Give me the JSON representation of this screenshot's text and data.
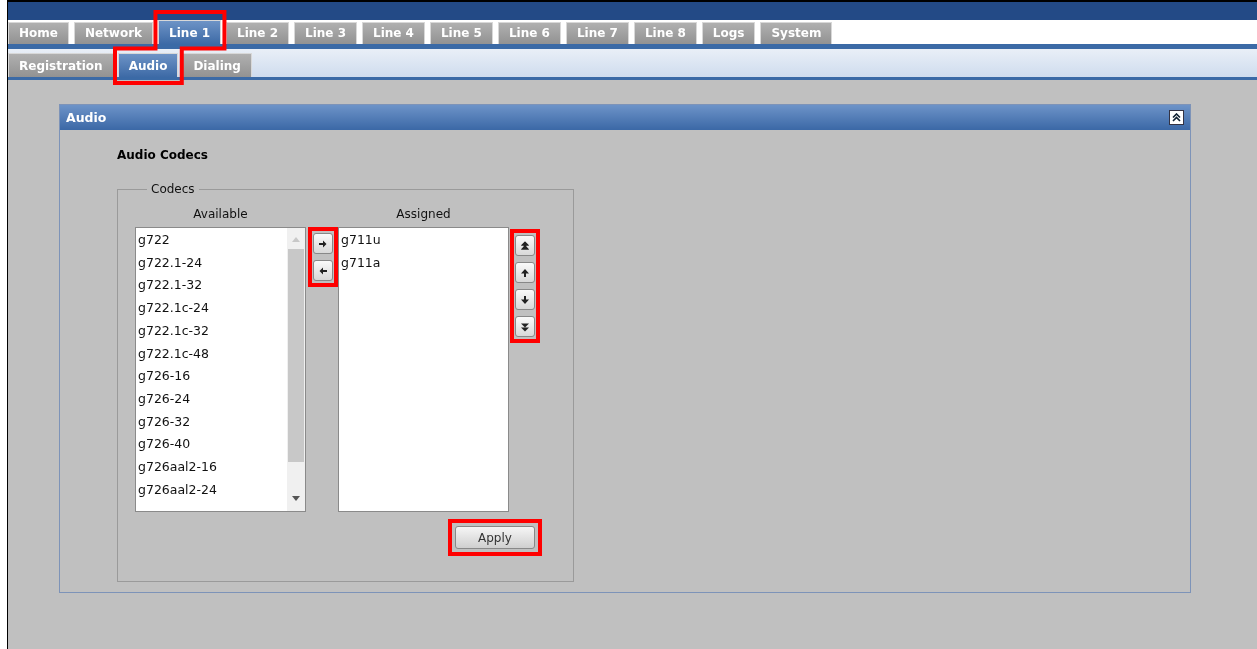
{
  "top_tabs": [
    {
      "label": "Home",
      "selected": false,
      "highlighted": false
    },
    {
      "label": "Network",
      "selected": false,
      "highlighted": false
    },
    {
      "label": "Line 1",
      "selected": true,
      "highlighted": true
    },
    {
      "label": "Line 2",
      "selected": false,
      "highlighted": false
    },
    {
      "label": "Line 3",
      "selected": false,
      "highlighted": false
    },
    {
      "label": "Line 4",
      "selected": false,
      "highlighted": false
    },
    {
      "label": "Line 5",
      "selected": false,
      "highlighted": false
    },
    {
      "label": "Line 6",
      "selected": false,
      "highlighted": false
    },
    {
      "label": "Line 7",
      "selected": false,
      "highlighted": false
    },
    {
      "label": "Line 8",
      "selected": false,
      "highlighted": false
    },
    {
      "label": "Logs",
      "selected": false,
      "highlighted": false
    },
    {
      "label": "System",
      "selected": false,
      "highlighted": false
    }
  ],
  "sub_tabs": [
    {
      "label": "Registration",
      "selected": false,
      "highlighted": false
    },
    {
      "label": "Audio",
      "selected": true,
      "highlighted": true
    },
    {
      "label": "Dialing",
      "selected": false,
      "highlighted": false
    }
  ],
  "panel": {
    "title": "Audio",
    "section_title": "Audio Codecs",
    "group": {
      "legend": "Codecs",
      "available": {
        "heading": "Available",
        "items": [
          "g722",
          "g722.1-24",
          "g722.1-32",
          "g722.1c-24",
          "g722.1c-32",
          "g722.1c-48",
          "g726-16",
          "g726-24",
          "g726-32",
          "g726-40",
          "g726aal2-16",
          "g726aal2-24"
        ]
      },
      "assigned": {
        "heading": "Assigned",
        "items": [
          "g711u",
          "g711a"
        ]
      },
      "transfer_buttons": {
        "highlighted": true
      },
      "order_buttons": {
        "highlighted": true
      },
      "apply": {
        "label": "Apply",
        "highlighted": true
      }
    }
  }
}
